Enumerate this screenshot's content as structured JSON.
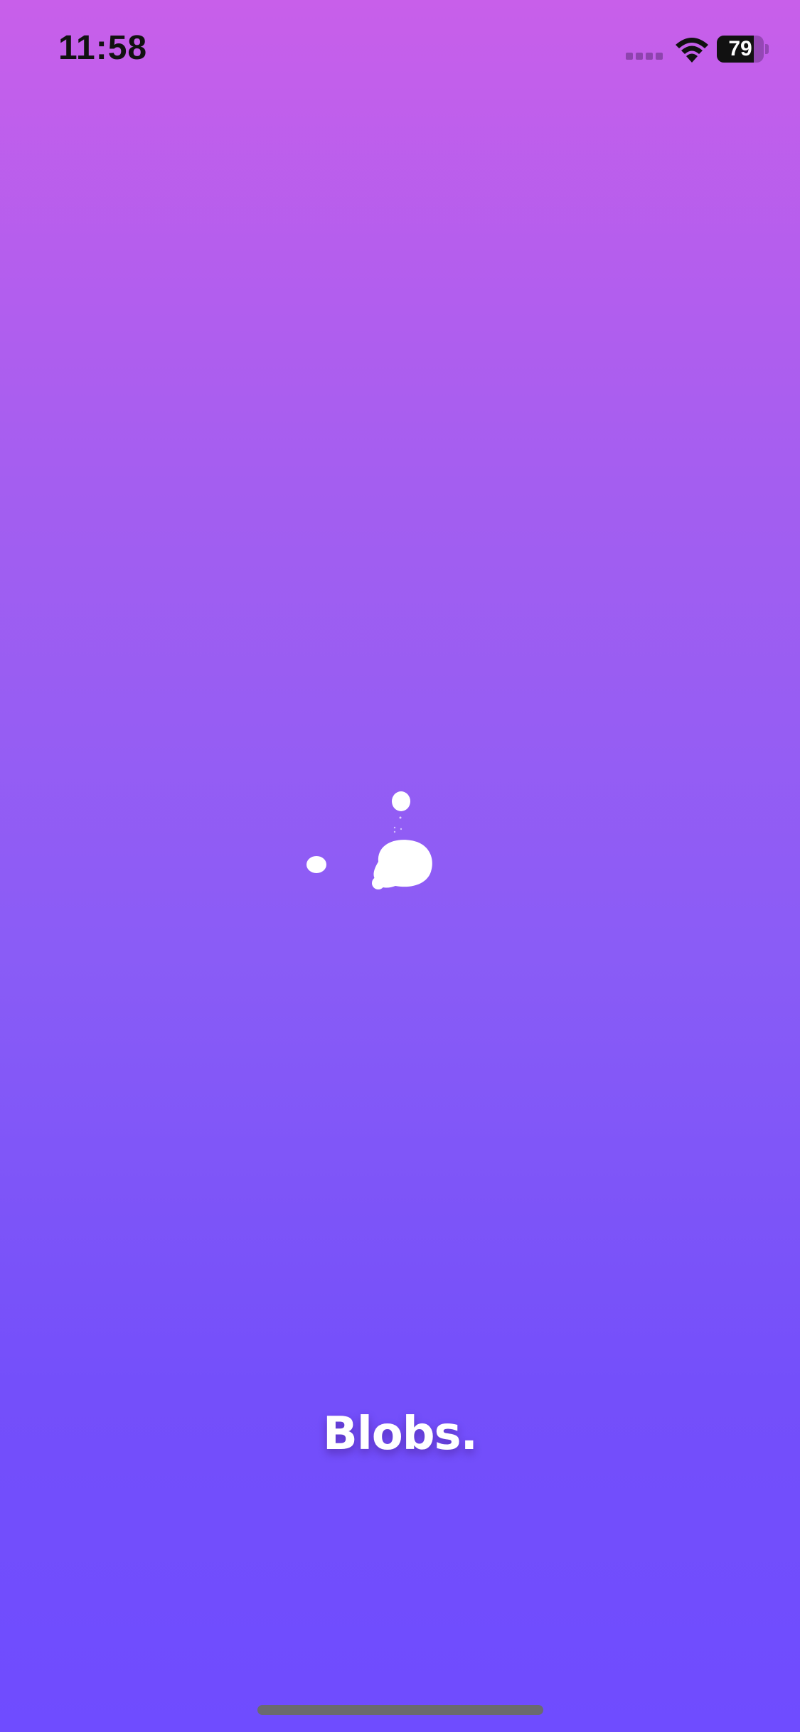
{
  "status_bar": {
    "time": "11:58",
    "battery_level": "79",
    "battery_fraction": 0.79,
    "icons": [
      "signal-icon",
      "wifi-icon",
      "battery-icon"
    ]
  },
  "app": {
    "name": "Blobs."
  },
  "colors": {
    "gradient_top": "#c85fea",
    "gradient_bottom": "#6f4cff",
    "blob": "#ffffff"
  }
}
